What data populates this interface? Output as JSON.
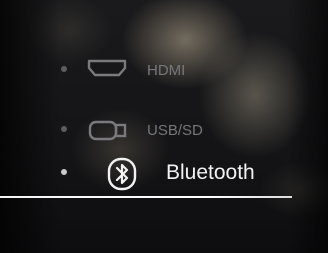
{
  "source_menu": {
    "items": [
      {
        "label": "HDMI",
        "icon": "hdmi-icon",
        "selected": false
      },
      {
        "label": "USB/SD",
        "icon": "usb-icon",
        "selected": false
      },
      {
        "label": "Bluetooth",
        "icon": "bluetooth-icon",
        "selected": true
      }
    ]
  },
  "colors": {
    "selected_text": "#f2f2f2",
    "unselected_text": "#76767a",
    "selection_line": "#ffffff",
    "background": "#0b0b0d"
  }
}
